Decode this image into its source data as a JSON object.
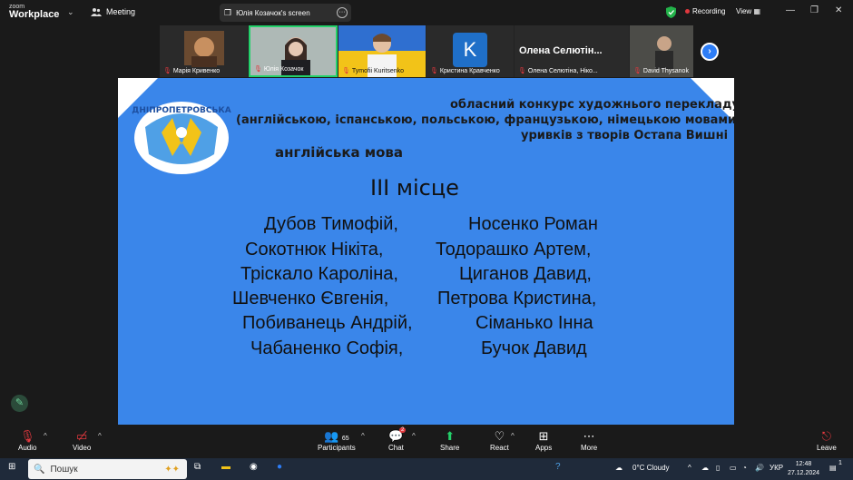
{
  "topbar": {
    "logo_small": "zoom",
    "logo_large": "Workplace",
    "meeting_label": "Meeting",
    "screen_label": "Юлія Козачок's screen",
    "recording_label": "Recording",
    "view_label": "View",
    "recording_color": "#e0383e"
  },
  "participants_strip": [
    {
      "name": "Марія Кривенко"
    },
    {
      "name": "Юлія Козачок"
    },
    {
      "name": "Tymofii Kuritsenko"
    },
    {
      "name": "Кристина Кравченко",
      "initial": "K"
    },
    {
      "name": "Олена Селютіна, Ніко...",
      "heading": "Олена Селютін..."
    },
    {
      "name": "David Thysanok"
    }
  ],
  "slide": {
    "logo_text": "ДНІПРОПЕТРОВСЬКА",
    "header_line1": "обласний конкурс художнього перекладу",
    "header_line2": "(англійською, іспанською, польською, французькою, німецькою мовами)",
    "header_line3": "уривків з творів Остапа Вишні",
    "language": "англійська мова",
    "place": "ІІІ місце",
    "left_names": [
      "Дубов Тимофій,",
      "Сокотнюк Нікіта,",
      "Тріскало Кароліна,",
      "Шевченко Євгенія,",
      "Побиванець Андрій,",
      "Чабаненко Софія,"
    ],
    "right_names": [
      "Носенко Роман",
      "Тодорашко Артем,",
      "Циганов Давид,",
      "Петрова Кристина,",
      "Сіманько Інна",
      "Бучок Давид"
    ],
    "background_color": "#3a86ea"
  },
  "controls": {
    "audio": "Audio",
    "video": "Video",
    "participants": "Participants",
    "participants_count": "65",
    "chat": "Chat",
    "chat_badge": "2",
    "share": "Share",
    "react": "React",
    "apps": "Apps",
    "more": "More",
    "leave": "Leave"
  },
  "taskbar": {
    "search_placeholder": "Пошук",
    "weather": "0°C  Cloudy",
    "language": "УКР",
    "time": "12:48",
    "date": "27.12.2024",
    "notifications": "1"
  }
}
